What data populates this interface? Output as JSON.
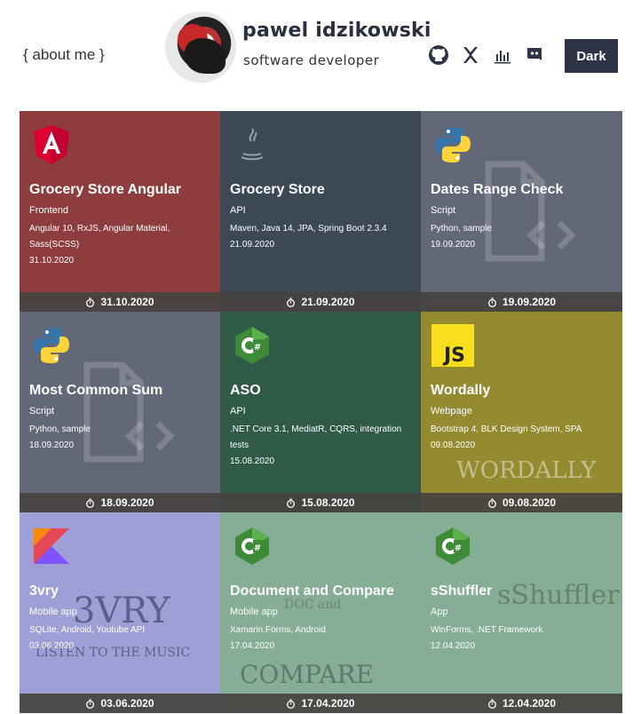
{
  "header": {
    "about_label": "{ about me }",
    "name": "pawel idzikowski",
    "role": "software developer",
    "theme_button": "Dark",
    "social_icons": [
      "github-icon",
      "stackoverflow-icon",
      "stats-icon",
      "discord-icon"
    ]
  },
  "projects": [
    {
      "title": "Grocery Store Angular",
      "kind": "Frontend",
      "tags": "Angular 10, RxJS, Angular Material, Sass(SCSS)",
      "date": "31.10.2020",
      "logo": "angular-logo-icon",
      "bg": "#8d3d3d"
    },
    {
      "title": "Grocery Store",
      "kind": "API",
      "tags": "Maven, Java 14, JPA, Spring Boot 2.3.4",
      "date": "21.09.2020",
      "logo": "java-logo-icon",
      "bg": "#3d4855"
    },
    {
      "title": "Dates Range Check",
      "kind": "Script",
      "tags": "Python, sample",
      "date": "19.09.2020",
      "logo": "python-logo-icon",
      "bg": "#636878"
    },
    {
      "title": "Most Common Sum",
      "kind": "Script",
      "tags": "Python, sample",
      "date": "18.09.2020",
      "logo": "python-logo-icon",
      "bg": "#636878"
    },
    {
      "title": "ASO",
      "kind": "API",
      "tags": ".NET Core 3.1, MediatR, CQRS, integration tests",
      "date": "15.08.2020",
      "logo": "csharp-logo-icon",
      "bg": "#2f5a48"
    },
    {
      "title": "Wordally",
      "kind": "Webpage",
      "tags": "Bootstrap 4, BLK Design System, SPA",
      "date": "09.08.2020",
      "logo": "javascript-logo-icon",
      "bg": "#948a2f"
    },
    {
      "title": "3vry",
      "kind": "Mobile app",
      "tags": "SQLite, Android, Youtube API",
      "date": "03.06.2020",
      "logo": "kotlin-logo-icon",
      "bg": "#9e9fd6"
    },
    {
      "title": "Document and Compare",
      "kind": "Mobile app",
      "tags": "Xamarin.Forms, Android",
      "date": "17.04.2020",
      "logo": "csharp-logo-icon",
      "bg": "#86ad95"
    },
    {
      "title": "sShuffler",
      "kind": "App",
      "tags": "WinForms, .NET Framework",
      "date": "12.04.2020",
      "logo": "csharp-logo-icon",
      "bg": "#86ad95"
    }
  ],
  "watermarks": {
    "wordally": "WORDALLY",
    "compare": "COMPARE",
    "doc": "DOC and",
    "shuffler": "sShuffler",
    "vry": "3VRY",
    "music": "LISTEN TO THE MUSIC"
  }
}
